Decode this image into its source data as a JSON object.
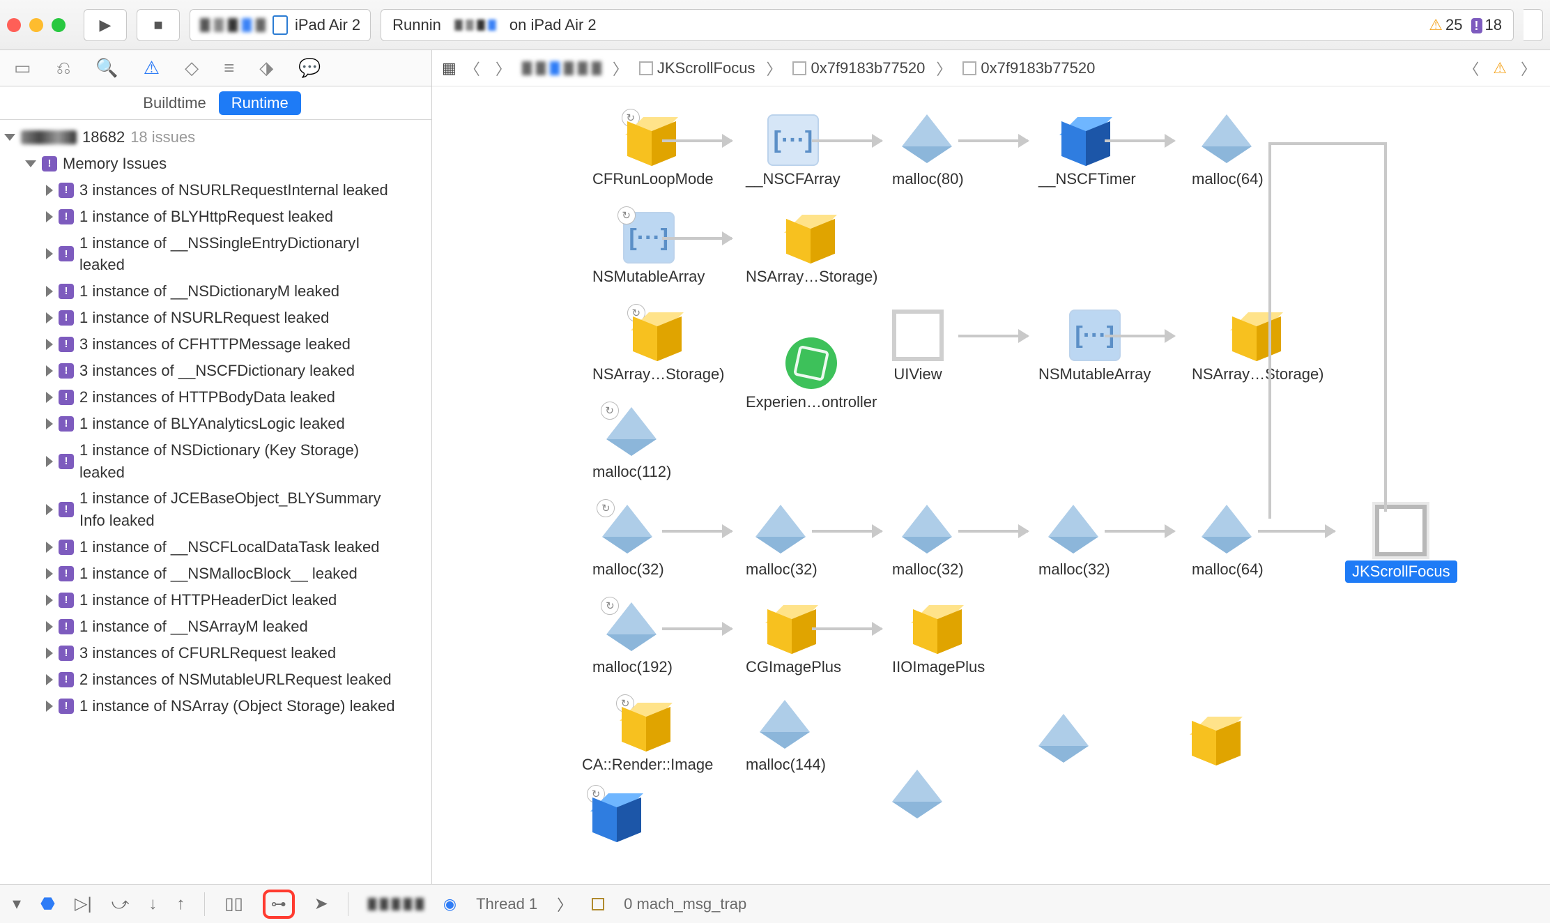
{
  "toolbar": {
    "scheme_device": "iPad Air 2",
    "status_prefix": "Runnin",
    "status_suffix": "on iPad Air 2",
    "warn_count": "25",
    "error_count": "18"
  },
  "segmented": {
    "buildtime": "Buildtime",
    "runtime": "Runtime"
  },
  "tree": {
    "pid": "18682",
    "issue_count": "18 issues",
    "memory_header": "Memory Issues",
    "items": [
      "3 instances of NSURLRequestInternal leaked",
      "1 instance of BLYHttpRequest leaked",
      "1 instance of __NSSingleEntryDictionaryI leaked",
      "1 instance of __NSDictionaryM leaked",
      "1 instance of NSURLRequest leaked",
      "3 instances of CFHTTPMessage leaked",
      "3 instances of __NSCFDictionary leaked",
      "2 instances of HTTPBodyData leaked",
      "1 instance of BLYAnalyticsLogic leaked",
      "1 instance of NSDictionary (Key Storage) leaked",
      "1 instance of JCEBaseObject_BLYSummary Info leaked",
      "1 instance of __NSCFLocalDataTask leaked",
      "1 instance of __NSMallocBlock__ leaked",
      "1 instance of HTTPHeaderDict leaked",
      "1 instance of __NSArrayM leaked",
      "3 instances of CFURLRequest leaked",
      "2 instances of NSMutableURLRequest leaked",
      "1 instance of NSArray (Object Storage) leaked"
    ]
  },
  "pathbar": {
    "crumb1": "JKScrollFocus",
    "crumb2": "0x7f9183b77520",
    "crumb3": "0x7f9183b77520"
  },
  "graph": {
    "n_cfrunloop": "CFRunLoopMode",
    "n_nscfarray": "__NSCFArray",
    "n_malloc80": "malloc(80)",
    "n_nscftimer": "__NSCFTimer",
    "n_malloc64a": "malloc(64)",
    "n_nsmutarray": "NSMutableArray",
    "n_nsarraystor1": "NSArray…Storage)",
    "n_nsarraystor2": "NSArray…Storage)",
    "n_uiview": "UIView",
    "n_nsmutarray2": "NSMutableArray",
    "n_nsarraystor3": "NSArray…Storage)",
    "n_experien": "Experien…ontroller",
    "n_malloc112": "malloc(112)",
    "n_malloc32a": "malloc(32)",
    "n_malloc32b": "malloc(32)",
    "n_malloc32c": "malloc(32)",
    "n_malloc32d": "malloc(32)",
    "n_malloc64b": "malloc(64)",
    "n_jkscroll": "JKScrollFocus",
    "n_malloc192": "malloc(192)",
    "n_cgimage": "CGImagePlus",
    "n_iioimage": "IIOImagePlus",
    "n_carender": "CA::Render::Image",
    "n_malloc144": "malloc(144)"
  },
  "debugbar": {
    "thread": "Thread 1",
    "frame": "0 mach_msg_trap"
  }
}
